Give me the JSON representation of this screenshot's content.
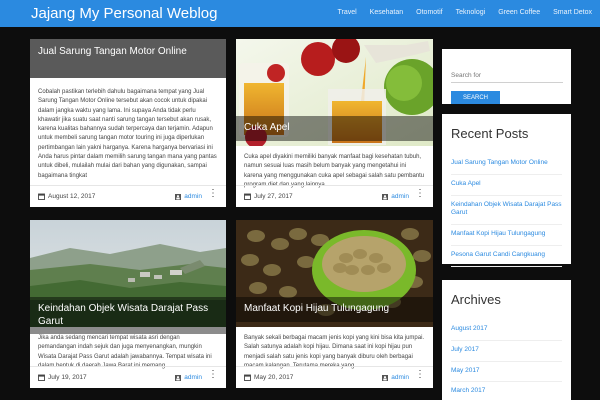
{
  "site": {
    "title": "Jajang My Personal Weblog"
  },
  "nav": [
    "Travel",
    "Kesehatan",
    "Otomotif",
    "Teknologi",
    "Green Coffee",
    "Smart Detox"
  ],
  "posts": [
    {
      "title": "Jual Sarung Tangan Motor Online",
      "excerpt": "Cobalah pastikan terlebih dahulu bagaimana tempat yang Jual Sarung Tangan Motor Online tersebut akan cocok untuk dipakai dalam jangka waktu yang lama. Ini supaya Anda tidak perlu khawatir jika suatu saat nanti sarung tangan tersebut akan rusak, karena kualitas bahannya sudah terpercaya dan terjamin. Adapun untuk membeli sarung tangan motor touring ini juga diperlukan pertimbangan lain yakni harganya. Karena harganya bervariasi ini Anda harus pintar dalam memilih sarung tangan mana yang pantas untuk dibeli, mulailah mulai dari bahan yang digunakan, sampai bagaimana tingkat",
      "date": "August 12, 2017",
      "author": "admin"
    },
    {
      "title": "Cuka Apel",
      "excerpt": "Cuka apel diyakini memiliki banyak manfaat bagi kesehatan tubuh, namun sesuai luas masih belum banyak yang mengetahui ini karena yang menggunakan cuka apel sebagai salah satu pembantu program diet dan yang lainnya.",
      "date": "July 27, 2017",
      "author": "admin"
    },
    {
      "title": "Keindahan Objek Wisata Darajat Pass Garut",
      "excerpt": "Jika anda sedang mencari tempat wisata asri dengan pemandangan indah sejuk dan juga menyenangkan, mungkin Wisata Darajat Pass Garut adalah jawabannya. Tempat wisata ini dalam bentuk di daerah Jawa Barat ini memang",
      "date": "July 19, 2017",
      "author": "admin"
    },
    {
      "title": "Manfaat Kopi Hijau Tulungagung",
      "excerpt": "Banyak sekali berbagai macam jenis kopi yang kini bisa kita jumpai. Salah satunya adalah kopi hijau. Dimana saat ini kopi hijau pun menjadi salah satu jenis kopi yang banyak diburu oleh berbagai macam kalangan. Terutama mereka yang",
      "date": "May 20, 2017",
      "author": "admin"
    }
  ],
  "search": {
    "placeholder": "Search for",
    "button_label": "SEARCH"
  },
  "recent_posts": {
    "title": "Recent Posts",
    "items": [
      "Jual Sarung Tangan Motor Online",
      "Cuka Apel",
      "Keindahan Objek Wisata Darajat Pass Garut",
      "Manfaat Kopi Hijau Tulungagung",
      "Pesona Garut Candi Cangkuang"
    ]
  },
  "archives": {
    "title": "Archives",
    "items": [
      "August 2017",
      "July 2017",
      "May 2017",
      "March 2017"
    ]
  },
  "colors": {
    "accent": "#2b8ae0",
    "background": "#0d0d0d"
  }
}
